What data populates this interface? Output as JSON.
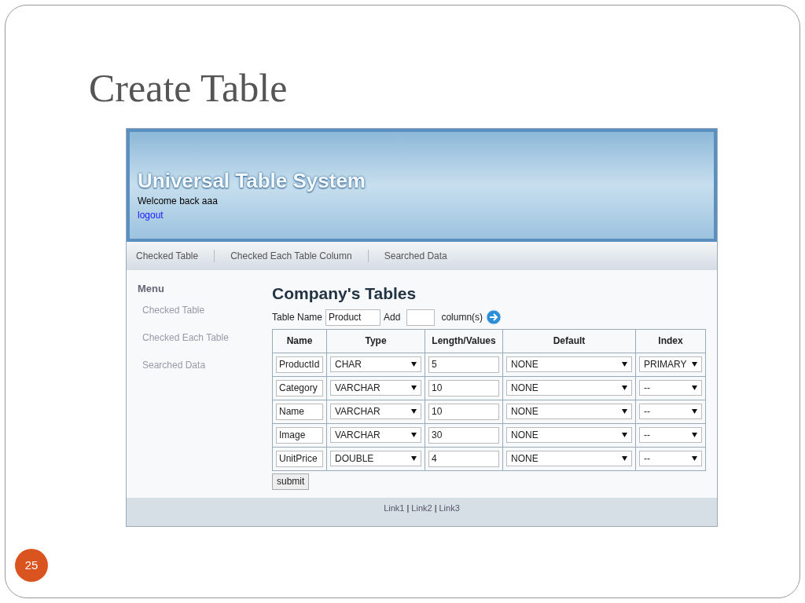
{
  "slide": {
    "title": "Create Table",
    "page_number": "25"
  },
  "header": {
    "site_title": "Universal Table System",
    "welcome": "Welcome back aaa",
    "logout": "logout"
  },
  "nav": [
    "Checked Table",
    "Checked Each Table Column",
    "Searched Data"
  ],
  "menu": {
    "heading": "Menu",
    "items": [
      "Checked Table",
      "Checked Each Table",
      "Searched Data"
    ]
  },
  "content": {
    "heading": "Company's Tables",
    "table_name_label": "Table Name",
    "table_name_value": "Product",
    "add_label": "Add",
    "columns_label": "column(s)",
    "table": {
      "columns": [
        "Name",
        "Type",
        "Length/Values",
        "Default",
        "Index"
      ],
      "rows": [
        {
          "name": "ProductId",
          "type": "CHAR",
          "length": "5",
          "default": "NONE",
          "index": "PRIMARY"
        },
        {
          "name": "Category",
          "type": "VARCHAR",
          "length": "10",
          "default": "NONE",
          "index": "--"
        },
        {
          "name": "Name",
          "type": "VARCHAR",
          "length": "10",
          "default": "NONE",
          "index": "--"
        },
        {
          "name": "Image",
          "type": "VARCHAR",
          "length": "30",
          "default": "NONE",
          "index": "--"
        },
        {
          "name": "UnitPrice",
          "type": "DOUBLE",
          "length": "4",
          "default": "NONE",
          "index": "--"
        }
      ]
    },
    "submit": "submit"
  },
  "footer": [
    {
      "kind": "link",
      "text": "Link1"
    },
    {
      "kind": "separator",
      "text": "|"
    },
    {
      "kind": "link",
      "text": "Link2"
    },
    {
      "kind": "separator",
      "text": "|"
    },
    {
      "kind": "link",
      "text": "Link3"
    }
  ]
}
